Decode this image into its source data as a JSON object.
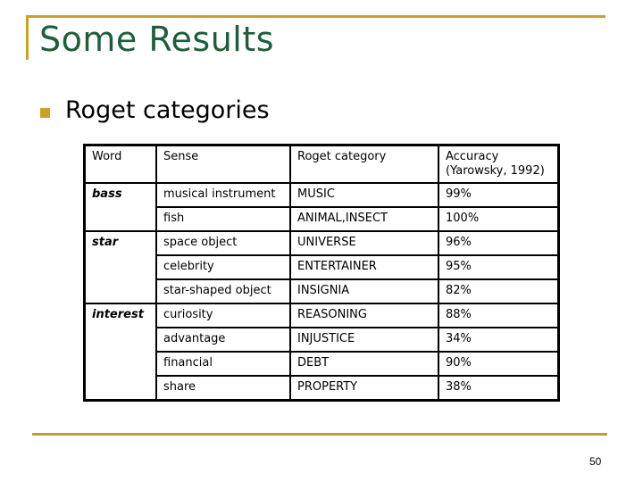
{
  "slide": {
    "title": "Some Results",
    "bullet": "Roget categories",
    "page_number": "50",
    "colors": {
      "accent": "#c9a227",
      "title": "#1e5e3a"
    }
  },
  "table": {
    "headers": [
      "Word",
      "Sense",
      "Roget category",
      "Accuracy (Yarowsky, 1992)"
    ],
    "groups": [
      {
        "word": "bass",
        "rows": [
          {
            "sense": "musical instrument",
            "category": "MUSIC",
            "accuracy": "99%"
          },
          {
            "sense": "fish",
            "category": "ANIMAL,INSECT",
            "accuracy": "100%"
          }
        ]
      },
      {
        "word": "star",
        "rows": [
          {
            "sense": "space object",
            "category": "UNIVERSE",
            "accuracy": "96%"
          },
          {
            "sense": "celebrity",
            "category": "ENTERTAINER",
            "accuracy": "95%"
          },
          {
            "sense": "star-shaped object",
            "category": "INSIGNIA",
            "accuracy": "82%"
          }
        ]
      },
      {
        "word": "interest",
        "rows": [
          {
            "sense": "curiosity",
            "category": "REASONING",
            "accuracy": "88%"
          },
          {
            "sense": "advantage",
            "category": "INJUSTICE",
            "accuracy": "34%"
          },
          {
            "sense": "financial",
            "category": "DEBT",
            "accuracy": "90%"
          },
          {
            "sense": "share",
            "category": "PROPERTY",
            "accuracy": "38%"
          }
        ]
      }
    ]
  }
}
